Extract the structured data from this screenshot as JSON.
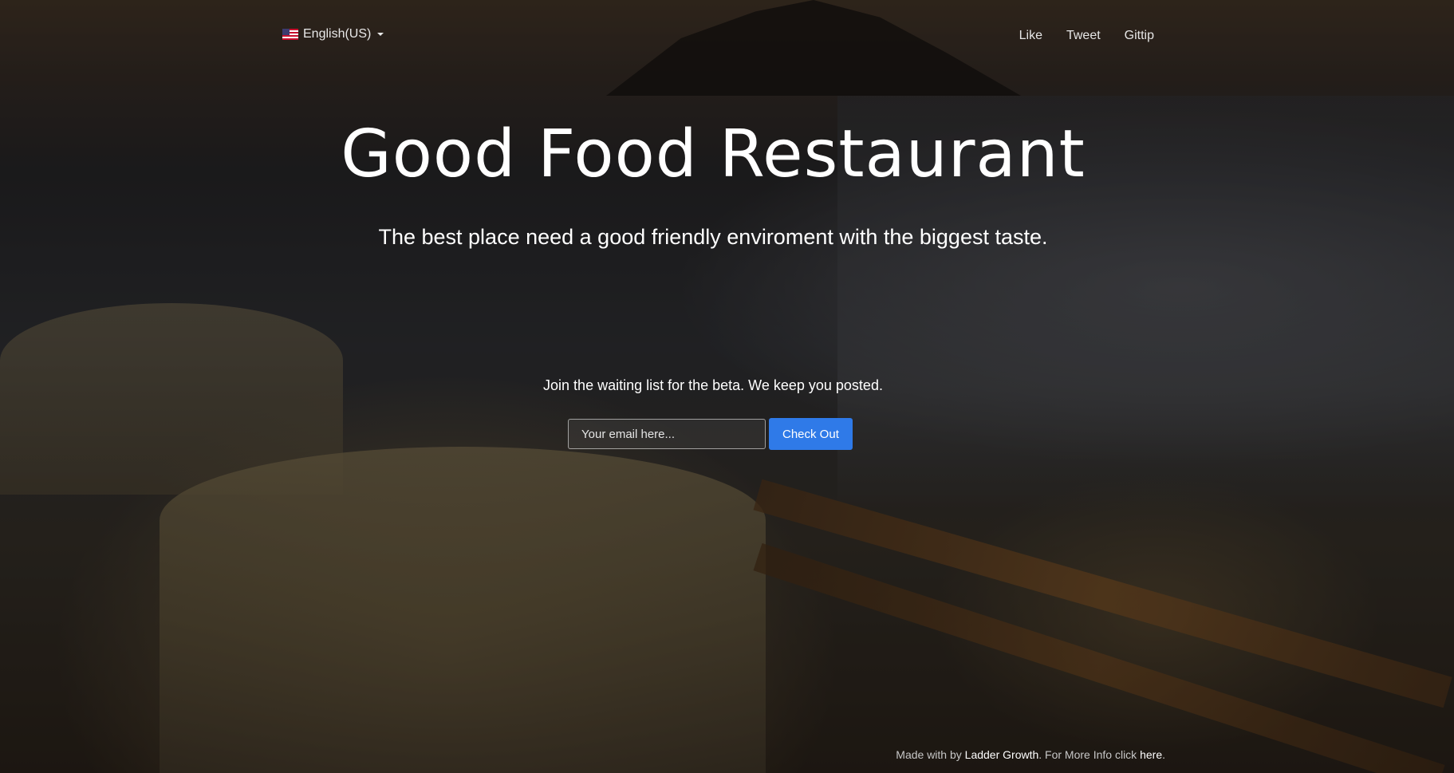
{
  "header": {
    "language": {
      "label": "English(US)",
      "flag_icon": "us-flag-icon"
    },
    "social": {
      "like": "Like",
      "tweet": "Tweet",
      "gittip": "Gittip"
    }
  },
  "hero": {
    "title": "Good Food Restaurant",
    "subtitle": "The best place need a good friendly enviroment with the biggest taste."
  },
  "signup": {
    "prompt": "Join the waiting list for the beta. We keep you posted.",
    "email_placeholder": "Your email here...",
    "email_value": "",
    "button_label": "Check Out",
    "button_color": "#2f7ae8"
  },
  "footer": {
    "made_with": "Made with by ",
    "brand_link": "Ladder Growth",
    "more_info": ". For More Info click ",
    "here_link": "here",
    "end": "."
  }
}
